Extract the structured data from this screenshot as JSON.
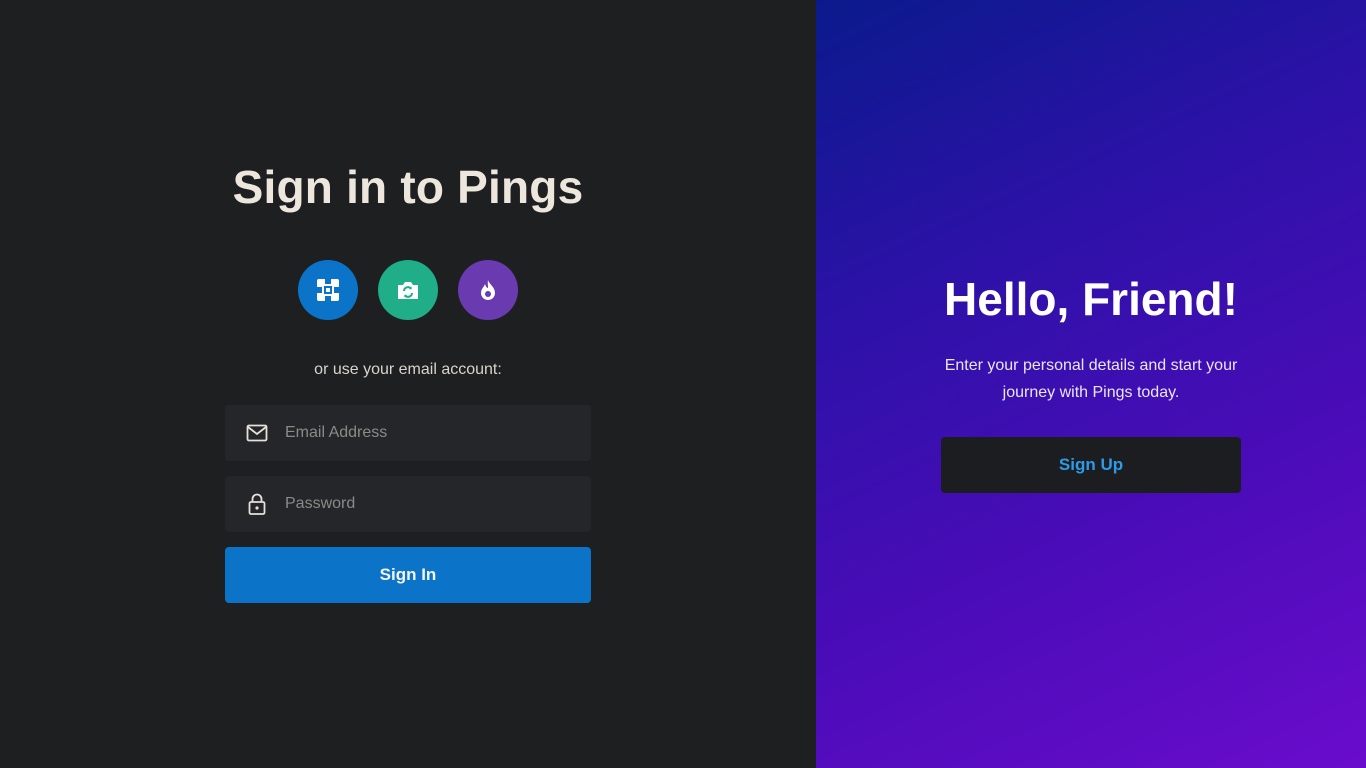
{
  "signin": {
    "title": "Sign in to Pings",
    "or_text": "or use your email account:",
    "social": [
      {
        "icon": "puzzle-icon",
        "color": "#0b74c8"
      },
      {
        "icon": "camera-icon",
        "color": "#1fae88"
      },
      {
        "icon": "flame-icon",
        "color": "#6a3ab0"
      }
    ],
    "email_placeholder": "Email Address",
    "password_placeholder": "Password",
    "button_label": "Sign In"
  },
  "signup": {
    "title": "Hello, Friend!",
    "description": "Enter your personal details and start your journey with Pings today.",
    "button_label": "Sign Up"
  },
  "colors": {
    "left_bg": "#1e1f21",
    "accent_blue": "#0b74c8",
    "gradient_start": "#0a1a8c",
    "gradient_end": "#6a0ccc",
    "signup_text": "#2c9be8"
  }
}
